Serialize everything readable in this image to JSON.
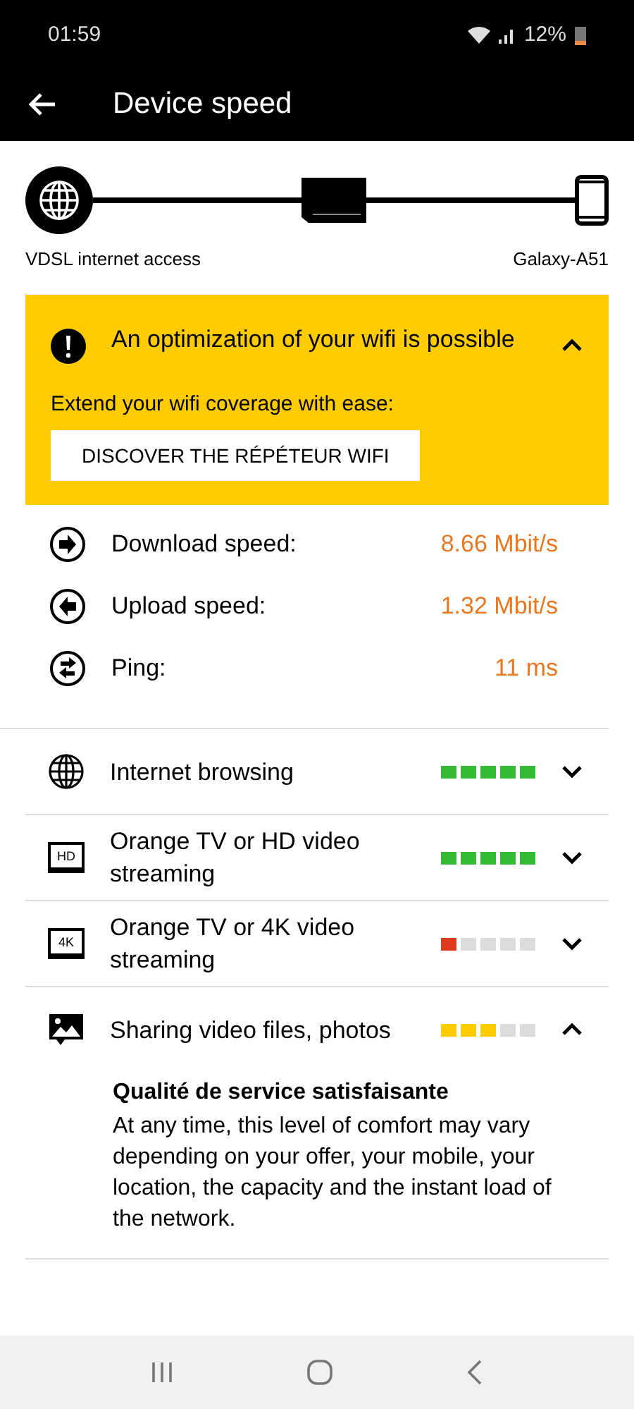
{
  "status_bar": {
    "time": "01:59",
    "battery": "12%"
  },
  "header": {
    "title": "Device speed"
  },
  "connection": {
    "source": "VDSL internet access",
    "device": "Galaxy-A51"
  },
  "alert": {
    "title": "An optimization of your wifi is possible",
    "expanded": true,
    "text": "Extend your wifi coverage with ease:",
    "button": "DISCOVER THE RÉPÉTEUR WIFI"
  },
  "speeds": [
    {
      "kind": "download",
      "label": "Download speed:",
      "value": "8.66 Mbit/s"
    },
    {
      "kind": "upload",
      "label": "Upload speed:",
      "value": "1.32 Mbit/s"
    },
    {
      "kind": "ping",
      "label": "Ping:",
      "value": "11 ms"
    }
  ],
  "services": [
    {
      "kind": "globe",
      "label": "Internet browsing",
      "stars": 5,
      "color": "#33bb33",
      "expanded": false
    },
    {
      "kind": "tv",
      "badge": "HD",
      "label": "Orange TV or HD video streaming",
      "stars": 5,
      "color": "#33bb33",
      "expanded": false
    },
    {
      "kind": "tv",
      "badge": "4K",
      "label": "Orange TV or 4K video streaming",
      "stars": 1,
      "color": "#dd3b1b",
      "expanded": false
    },
    {
      "kind": "photo",
      "label": "Sharing video files, photos",
      "stars": 3,
      "color": "#ffcc00",
      "expanded": true,
      "detail_title": "Qualité de service satisfaisante",
      "detail_text": "At any time, this level of comfort may vary depending on your offer, your mobile, your location, the capacity and the instant load of the network."
    }
  ]
}
